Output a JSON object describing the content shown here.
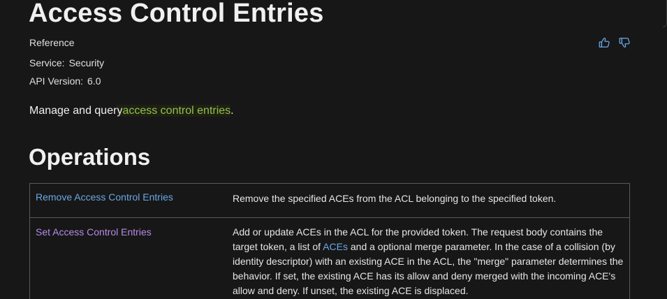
{
  "header": {
    "title": "Access Control Entries",
    "doc_type": "Reference",
    "service_label": "Service:",
    "service_value": "Security",
    "api_version_label": "API Version:",
    "api_version_value": "6.0",
    "feedback": {
      "thumbs_up_icon": "thumbs-up-icon",
      "thumbs_down_icon": "thumbs-down-icon"
    }
  },
  "summary": {
    "prefix": "Manage and quer",
    "highlight_letter": "y",
    "link_text": "access control entries",
    "suffix": "."
  },
  "operations": {
    "heading": "Operations",
    "rows": [
      {
        "name": "Remove Access Control Entries",
        "description": "Remove the specified ACEs from the ACL belonging to the specified token."
      },
      {
        "name": "Set Access Control Entries",
        "description_part1": "Add or update ACEs in the ACL for the provided token. The request body contains the target token, a list of ",
        "description_link": "ACEs",
        "description_part2": " and a optional merge parameter. In the case of a collision (by identity descriptor) with an existing ACE in the ACL, the \"merge\" parameter determines the behavior. If set, the existing ACE has its allow and deny merged with the incoming ACE's allow and deny. If unset, the existing ACE is displaced."
      }
    ]
  },
  "colors": {
    "background": "#171717",
    "link_blue": "#6aa8e6",
    "link_visited": "#b48ce6",
    "link_highlight": "#8fc34a"
  }
}
